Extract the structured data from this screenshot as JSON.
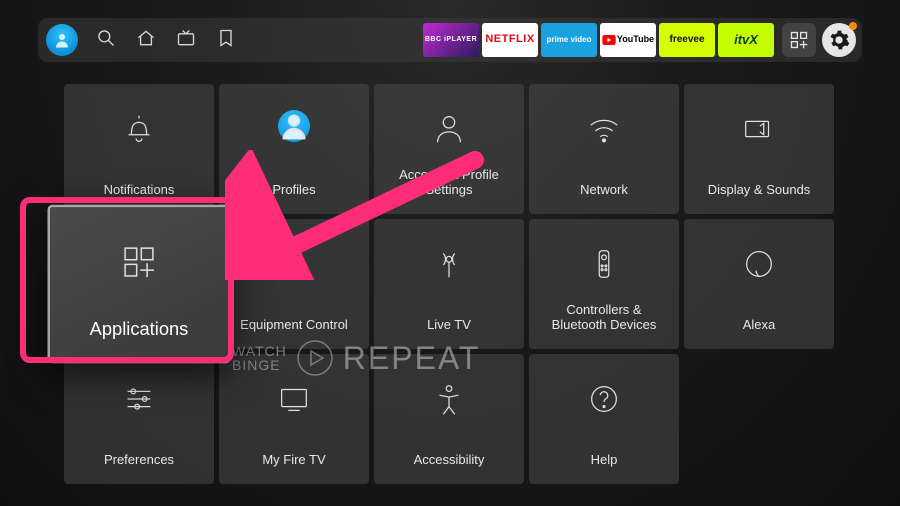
{
  "topbar": {
    "apps": [
      {
        "name": "bbc-iplayer",
        "label": "BBC iPLAYER",
        "bg": "linear-gradient(135deg,#c02bd5,#2b1b5a)",
        "fg": "#fff"
      },
      {
        "name": "netflix",
        "label": "NETFLIX",
        "bg": "#fff",
        "fg": "#e50914"
      },
      {
        "name": "prime-video",
        "label": "prime video",
        "bg": "#1aa1e0",
        "fg": "#fff"
      },
      {
        "name": "youtube",
        "label": "YouTube",
        "bg": "#fff",
        "fg": "#000"
      },
      {
        "name": "freevee",
        "label": "freevee",
        "bg": "#d6ff00",
        "fg": "#111"
      },
      {
        "name": "itvx",
        "label": "itvX",
        "bg": "#c6ff00",
        "fg": "#0a3c2b"
      }
    ]
  },
  "settings": {
    "tiles": [
      {
        "id": "notifications",
        "label": "Notifications"
      },
      {
        "id": "profiles",
        "label": "Profiles"
      },
      {
        "id": "account",
        "label": "Account & Profile Settings"
      },
      {
        "id": "network",
        "label": "Network"
      },
      {
        "id": "display",
        "label": "Display & Sounds"
      },
      {
        "id": "applications",
        "label": "Applications",
        "focused": true
      },
      {
        "id": "equipment",
        "label": "Equipment Control"
      },
      {
        "id": "livetv",
        "label": "Live TV"
      },
      {
        "id": "controllers",
        "label": "Controllers & Bluetooth Devices"
      },
      {
        "id": "alexa",
        "label": "Alexa"
      },
      {
        "id": "preferences",
        "label": "Preferences"
      },
      {
        "id": "myfiretv",
        "label": "My Fire TV"
      },
      {
        "id": "accessibility",
        "label": "Accessibility"
      },
      {
        "id": "help",
        "label": "Help"
      }
    ]
  },
  "watermark": {
    "small1": "WATCH",
    "small2": "BINGE",
    "big": "REPEAT"
  },
  "colors": {
    "highlight": "#ff2d78",
    "notify_dot": "#ff8a00"
  }
}
